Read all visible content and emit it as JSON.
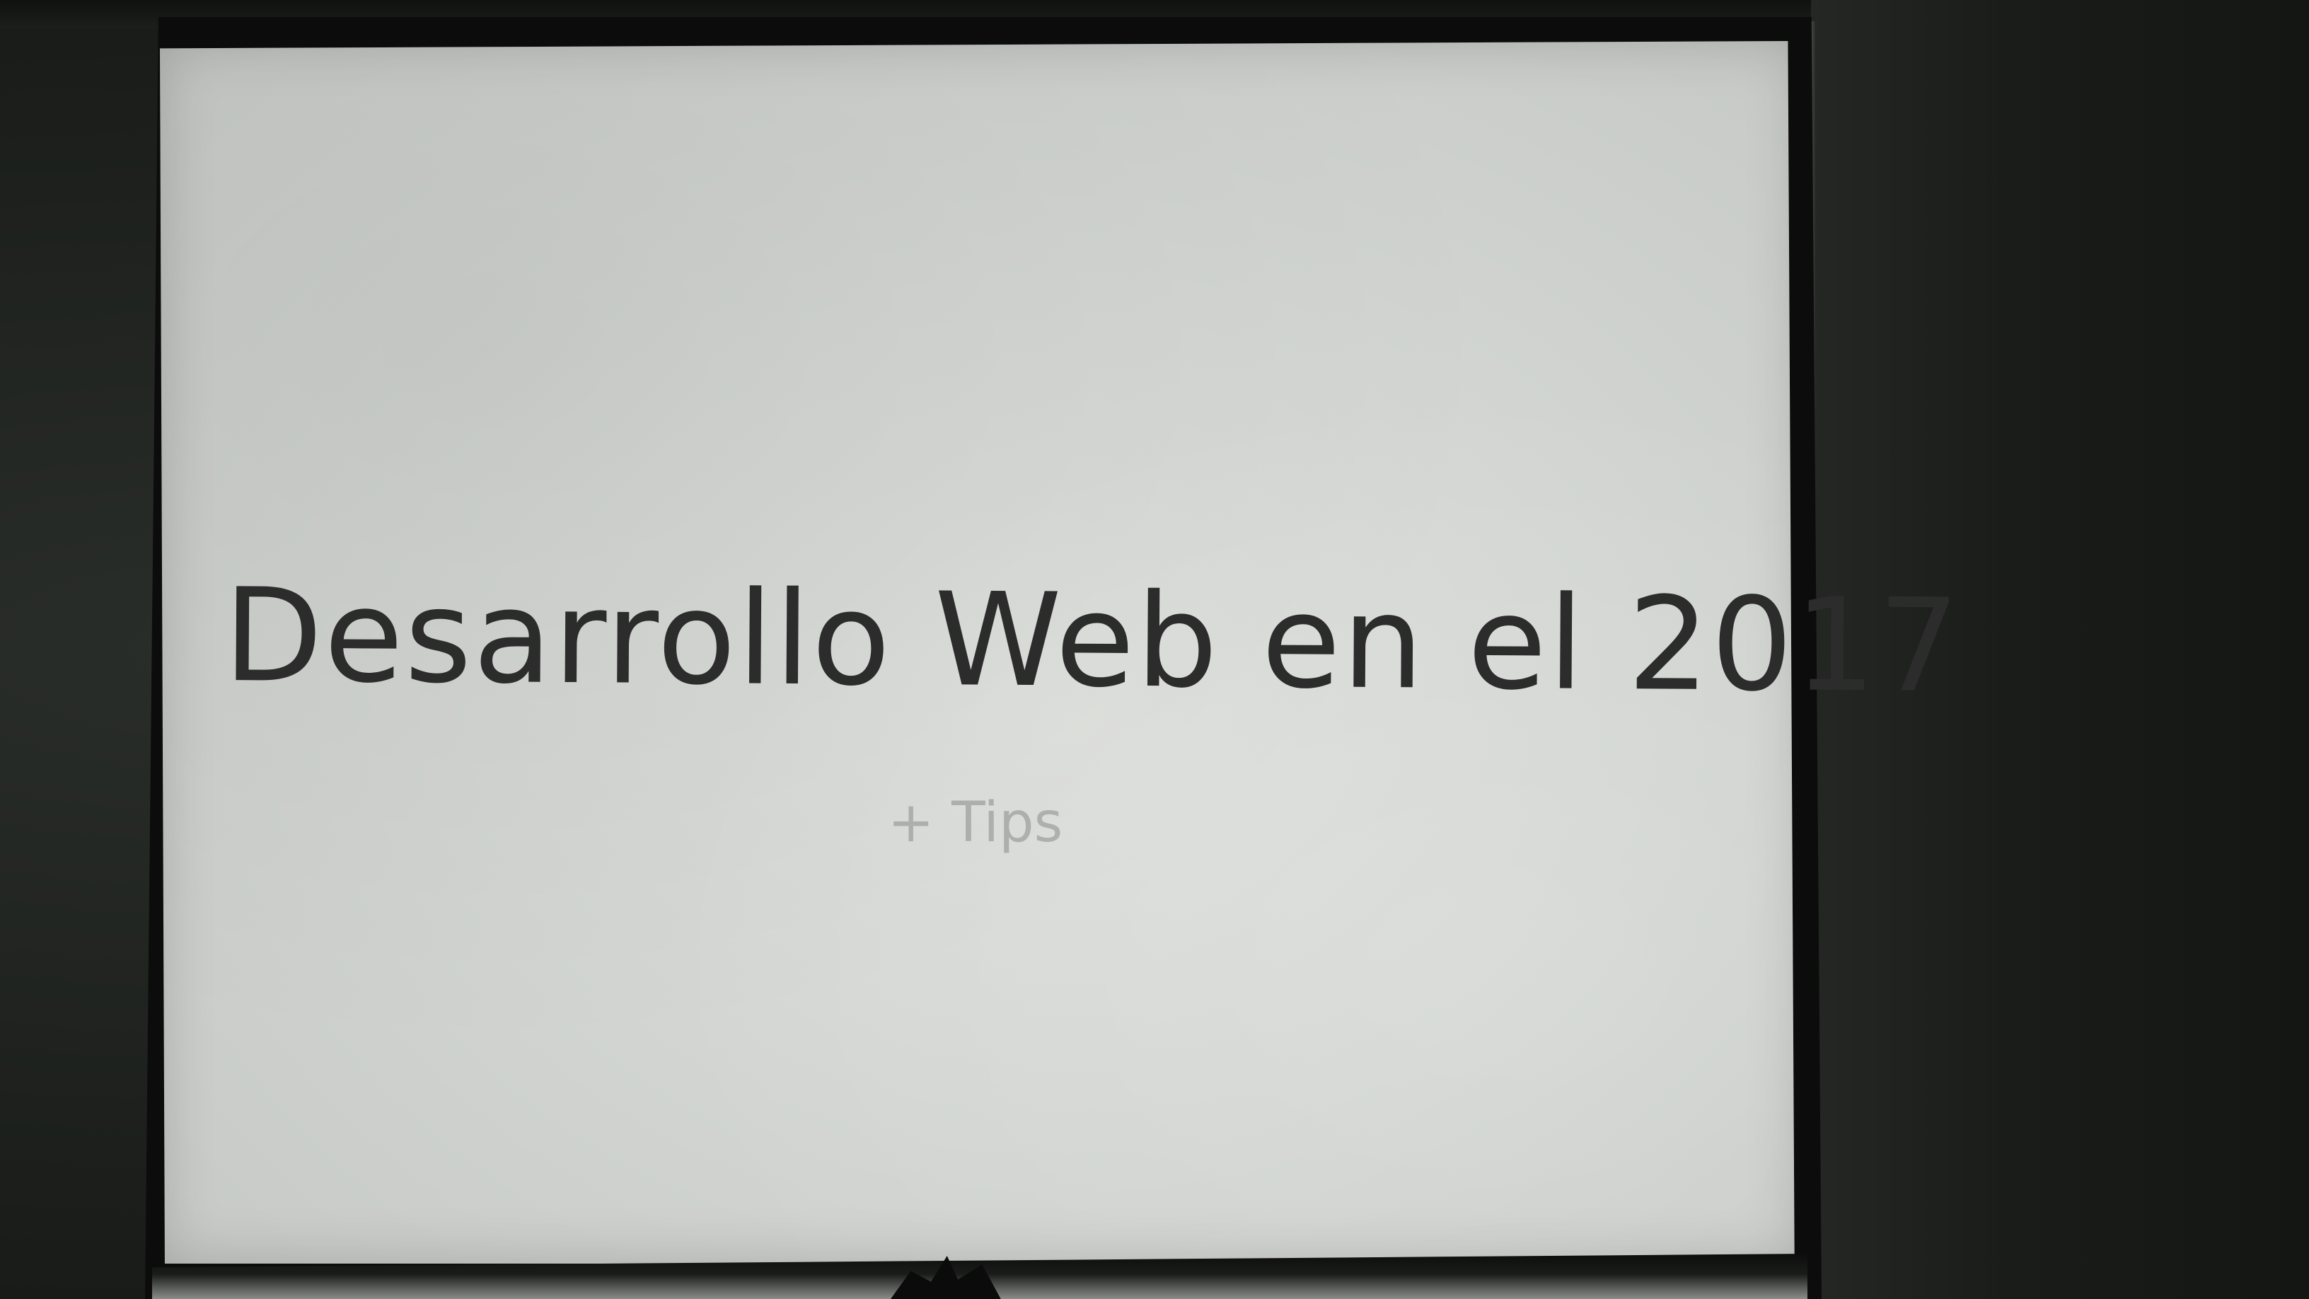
{
  "slide": {
    "title": "Desarrollo Web en el 2017",
    "subtitle": "+ Tips"
  }
}
